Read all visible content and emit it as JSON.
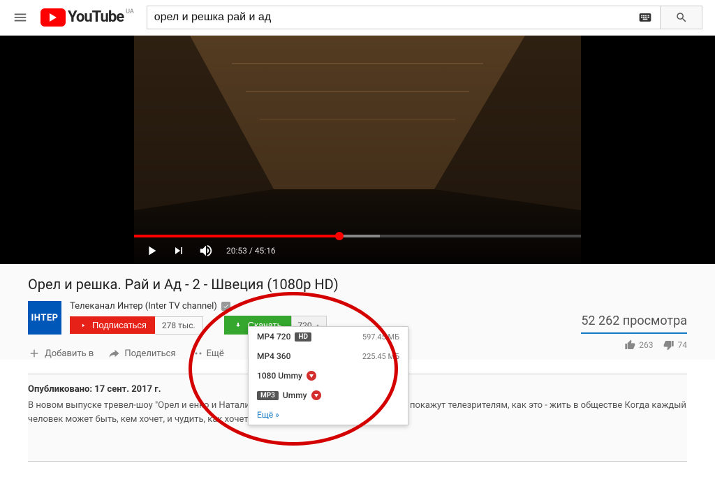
{
  "header": {
    "logo_text": "YouTube",
    "region": "UA",
    "search_value": "орел и решка рай и ад"
  },
  "player": {
    "current_time": "20:53",
    "duration": "45:16"
  },
  "video": {
    "title": "Орел и решка. Рай и Ад - 2 - Швеция (1080p HD)",
    "channel_name": "Телеканал Интер (Inter TV channel)",
    "channel_avatar_text": "ІНТЕР",
    "subscribe_label": "Подписаться",
    "sub_count": "278 тыс.",
    "views": "52 262 просмотра",
    "likes": "263",
    "dislikes": "74"
  },
  "download": {
    "button_label": "Скачать",
    "selected_quality": "720",
    "options": [
      {
        "label": "MP4 720",
        "badge": "HD",
        "size": "597.45 МБ"
      },
      {
        "label": "MP4 360",
        "badge": "",
        "size": "225.45 МБ"
      },
      {
        "label": "1080 Ummy",
        "ummy": true
      },
      {
        "label": "Ummy",
        "mp3": true,
        "ummy": true
      }
    ],
    "more_label": "Ещё »"
  },
  "actions": {
    "add": "Добавить в",
    "share": "Поделиться",
    "more": "Ещё"
  },
  "description": {
    "published": "Опубликовано: 17 сент. 2017 г.",
    "body_1": "В новом выпуске тревел-шоу \"Орел и ",
    "body_gap1": "                                          ",
    "body_2": "енко и Натали Неведрова отправятся в Швецию. И покажут телезрителям, как это - жить в обществе",
    "body_gap2": "                        ",
    "body_3": "Когда каждый человек может быть, кем хочет, и чудить, как хочет."
  }
}
